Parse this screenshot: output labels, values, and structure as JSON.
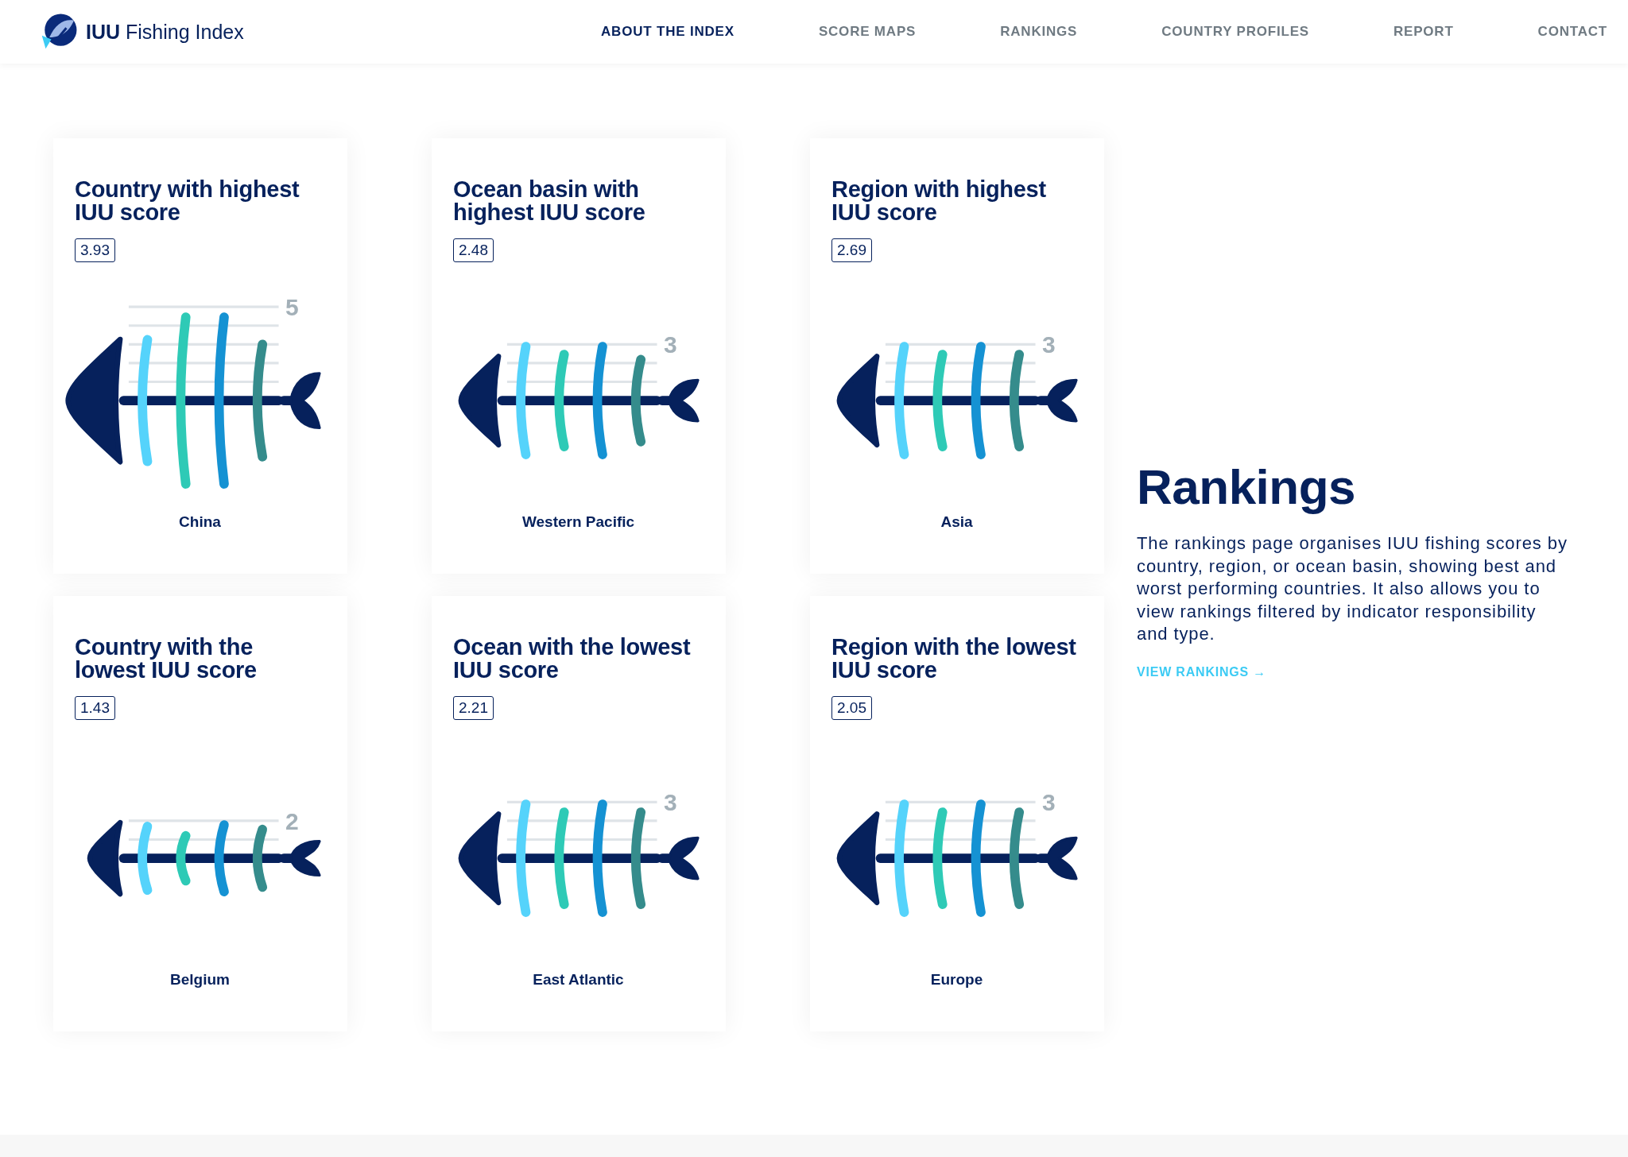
{
  "header": {
    "logo_text": "**IUU** Fishing Index",
    "nav": [
      {
        "label": "ABOUT THE INDEX",
        "selected": true
      },
      {
        "label": "SCORE MAPS",
        "selected": false
      },
      {
        "label": "RANKINGS",
        "selected": false
      },
      {
        "label": "COUNTRY PROFILES",
        "selected": false
      },
      {
        "label": "REPORT",
        "selected": false
      },
      {
        "label": "CONTACT",
        "selected": false
      }
    ]
  },
  "cards": [
    {
      "title": "Country with highest IUU score",
      "score": "3.93",
      "scale_max": "5",
      "name": "China"
    },
    {
      "title": "Ocean basin with highest IUU score",
      "score": "2.48",
      "scale_max": "3",
      "name": "Western Pacific"
    },
    {
      "title": "Region with highest IUU score",
      "score": "2.69",
      "scale_max": "3",
      "name": "Asia"
    },
    {
      "title": "Country with the lowest IUU score",
      "score": "1.43",
      "scale_max": "2",
      "name": "Belgium"
    },
    {
      "title": "Ocean with the lowest IUU score",
      "score": "2.21",
      "scale_max": "3",
      "name": "East Atlantic"
    },
    {
      "title": "Region with the lowest IUU score",
      "score": "2.05",
      "scale_max": "3",
      "name": "Europe"
    }
  ],
  "rankings": {
    "heading": "Rankings",
    "text": "The rankings page organises IUU fishing scores by country, region, or ocean basin, showing best and worst performing countries. It also allows you to view rankings filtered by indicator responsibility and type.",
    "link": "VIEW RANKINGS →"
  }
}
